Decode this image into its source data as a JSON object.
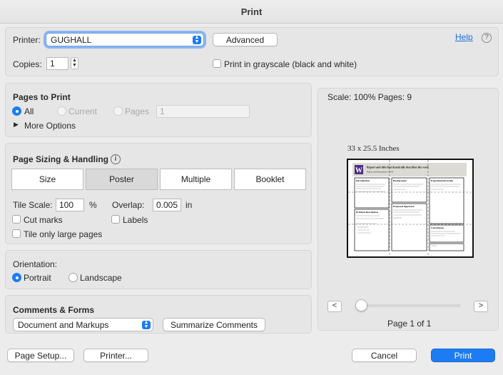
{
  "window": {
    "title": "Print"
  },
  "printer": {
    "label": "Printer:",
    "value": "GUGHALL",
    "advanced_label": "Advanced",
    "help_label": "Help",
    "help_icon": "?",
    "copies_label": "Copies:",
    "copies_value": "1",
    "grayscale_label": "Print in grayscale (black and white)"
  },
  "pages": {
    "title": "Pages to Print",
    "all_label": "All",
    "current_label": "Current",
    "pages_label": "Pages",
    "pages_range_value": "1",
    "more_options_label": "More Options"
  },
  "sizing": {
    "title": "Page Sizing & Handling",
    "info_icon": "i",
    "tabs": [
      "Size",
      "Poster",
      "Multiple",
      "Booklet"
    ],
    "selected_tab": "Poster",
    "tile_scale_label": "Tile Scale:",
    "tile_scale_value": "100",
    "tile_scale_unit": "%",
    "overlap_label": "Overlap:",
    "overlap_value": "0.005",
    "overlap_unit": "in",
    "cut_marks_label": "Cut marks",
    "labels_label": "Labels",
    "tile_only_large_label": "Tile only large pages"
  },
  "orientation": {
    "title": "Orientation:",
    "portrait_label": "Portrait",
    "landscape_label": "Landscape"
  },
  "comments": {
    "title": "Comments & Forms",
    "select_value": "Document and Markups",
    "summarize_label": "Summarize Comments"
  },
  "preview": {
    "scale_text": "Scale: 100% Pages: 9",
    "size_text": "33 x 25.5 Inches",
    "page_indicator": "Page 1 of 1",
    "prev_label": "<",
    "next_label": ">",
    "slider_position": 0,
    "poster": {
      "title": "Report and title that drastically describes the work",
      "subtitle": "Names and Department of UW",
      "logo_letter": "W",
      "sections": [
        "Introduction",
        "Background",
        "Experimental results",
        "Problem Description",
        "Proposed Approach",
        "Conclusions"
      ]
    }
  },
  "footer": {
    "page_setup_label": "Page Setup...",
    "printer_label": "Printer...",
    "cancel_label": "Cancel",
    "print_label": "Print"
  },
  "colors": {
    "accent": "#1d7cf2",
    "poster_header": "#dcdad4",
    "logo": "#4b2e83"
  }
}
